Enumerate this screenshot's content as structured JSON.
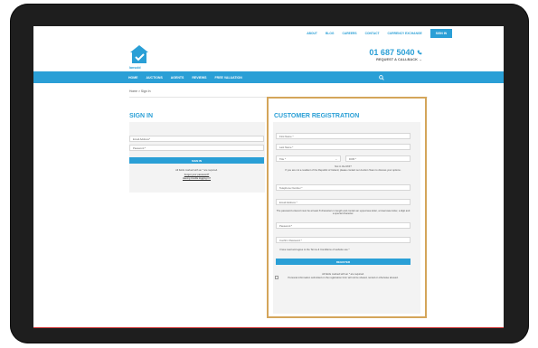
{
  "topnav": {
    "about": "ABOUT",
    "blog": "BLOG",
    "careers": "CAREERS",
    "contact": "CONTACT",
    "currency": "CURRENCY EXCHANGE",
    "signin": "SIGN IN"
  },
  "brand": {
    "name": "lansold",
    "color": "#2a9fd6"
  },
  "contact": {
    "phone": "01 687 5040",
    "callback": "REQUEST A CALLBACK"
  },
  "mainnav": [
    "HOME",
    "AUCTIONS",
    "AGENTS",
    "REVIEWS",
    "FREE VALUATION"
  ],
  "breadcrumb": "Home > Sign In",
  "signin": {
    "title": "SIGN IN",
    "email_placeholder": "Email Address*",
    "password_placeholder": "Password *",
    "button": "SIGN IN",
    "required_note": "All fields marked with an * are required.",
    "forgot_link": "Forgot your password?",
    "trouble_link": "Having trouble logging in?"
  },
  "registration": {
    "title": "CUSTOMER REGISTRATION",
    "first_name": "First Name *",
    "last_name": "Last Name *",
    "title_select": "Title *",
    "dob": "DOB *",
    "not_roi_heading": "Not in the ROI?",
    "not_roi_text": "If you are not a resident of the Republic of Ireland, please contact our Auction Team to discuss your options.",
    "telephone": "Telephone Number *",
    "email": "Email Address *",
    "password_rules": "The password entered must be at least 8 characters in length and contain an uppercase letter, a lowercase letter, a digit and a special character.",
    "password": "Password *",
    "confirm_password": "Confirm Password *",
    "terms": "I have read and agree to the Terms & Conditions of website use *",
    "button": "REGISTER",
    "required_note": "All fields marked with an * are required.",
    "privacy_note": "Personal information submitted on the registration form will not be shared, rented or otherwise abused."
  }
}
